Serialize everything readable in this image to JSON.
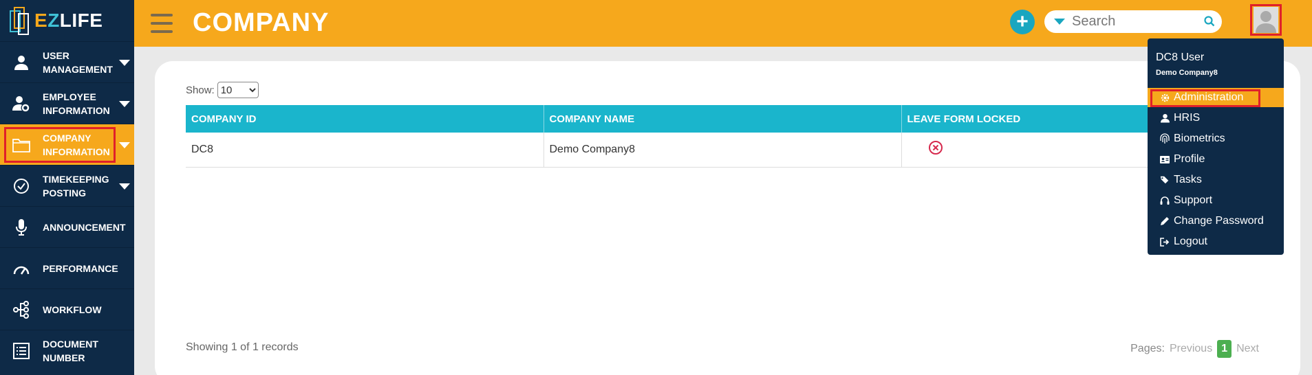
{
  "app": {
    "logo_text_e": "E",
    "logo_text_z": "Z",
    "logo_text_life": "LIFE"
  },
  "sidebar": {
    "items": [
      {
        "label1": "USER",
        "label2": "MANAGEMENT",
        "icon": "user-icon",
        "has_caret": true
      },
      {
        "label1": "EMPLOYEE",
        "label2": "INFORMATION",
        "icon": "user-gear-icon",
        "has_caret": true
      },
      {
        "label1": "COMPANY",
        "label2": "INFORMATION",
        "icon": "folder-icon",
        "has_caret": true,
        "active": true
      },
      {
        "label1": "TIMEKEEPING",
        "label2": "POSTING",
        "icon": "check-circle-icon",
        "has_caret": true
      },
      {
        "label1": "ANNOUNCEMENT",
        "label2": "",
        "icon": "microphone-icon",
        "has_caret": false
      },
      {
        "label1": "PERFORMANCE",
        "label2": "",
        "icon": "gauge-icon",
        "has_caret": false
      },
      {
        "label1": "WORKFLOW",
        "label2": "",
        "icon": "workflow-icon",
        "has_caret": false
      },
      {
        "label1": "DOCUMENT",
        "label2": "NUMBER",
        "icon": "list-icon",
        "has_caret": false
      }
    ]
  },
  "header": {
    "title": "COMPANY",
    "search_placeholder": "Search"
  },
  "content": {
    "show_label": "Show:",
    "show_value": "10",
    "show_options": [
      "10"
    ],
    "columns": [
      "COMPANY ID",
      "COMPANY NAME",
      "LEAVE FORM LOCKED"
    ],
    "rows": [
      {
        "company_id": "DC8",
        "company_name": "Demo Company8",
        "leave_form_locked": false
      }
    ],
    "showing_text": "Showing 1 of 1 records",
    "pagination": {
      "pages_label": "Pages:",
      "previous": "Previous",
      "current": "1",
      "next": "Next"
    }
  },
  "user_menu": {
    "user_name": "DC8 User",
    "company": "Demo Company8",
    "items": [
      {
        "label": "Administration",
        "icon": "gear-icon",
        "active": true
      },
      {
        "label": "HRIS",
        "icon": "user-icon"
      },
      {
        "label": "Biometrics",
        "icon": "fingerprint-icon"
      },
      {
        "label": "Profile",
        "icon": "id-card-icon"
      },
      {
        "label": "Tasks",
        "icon": "tags-icon"
      },
      {
        "label": "Support",
        "icon": "headset-icon"
      },
      {
        "label": "Change Password",
        "icon": "pencil-icon"
      },
      {
        "label": "Logout",
        "icon": "logout-icon"
      }
    ]
  },
  "colors": {
    "accent_orange": "#f6a81c",
    "navy": "#0e2a47",
    "teal": "#1ab5cc",
    "highlight_red": "#e0202a",
    "page_green": "#4caf50"
  }
}
